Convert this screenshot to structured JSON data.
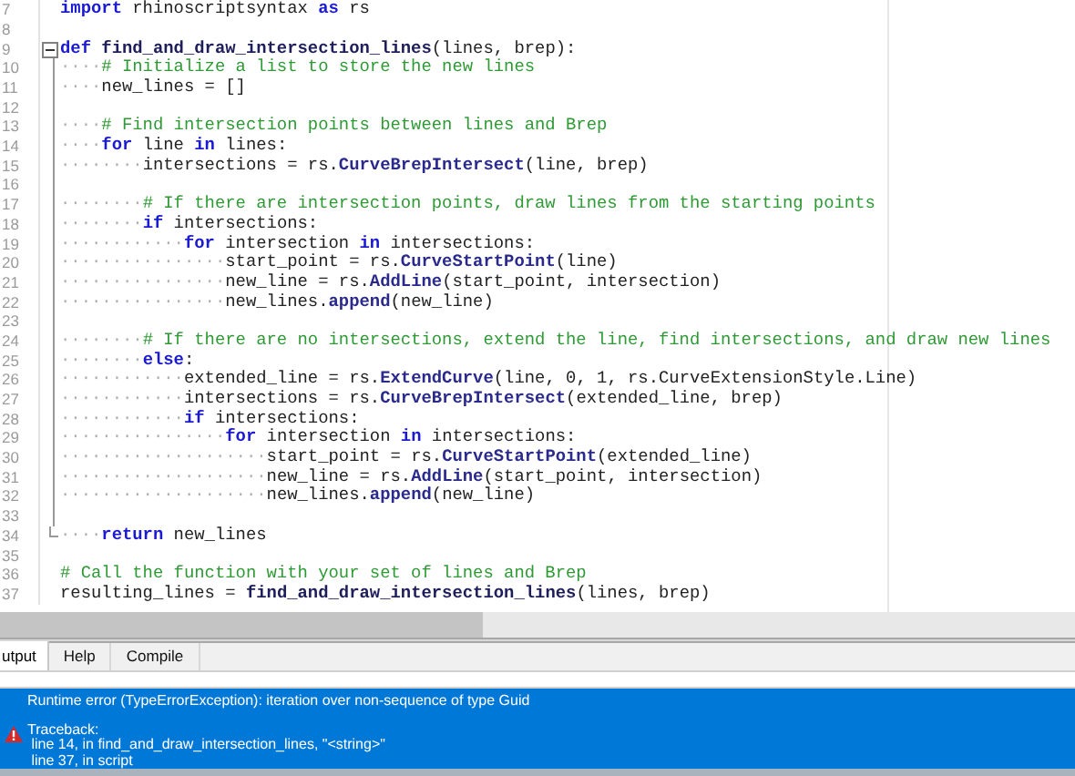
{
  "editor": {
    "lines": [
      {
        "number": "7",
        "segments": [
          {
            "kind": "keyword",
            "text": "import"
          },
          {
            "kind": "plain",
            "text": " rhinoscriptsyntax "
          },
          {
            "kind": "keyword",
            "text": "as"
          },
          {
            "kind": "plain",
            "text": " rs"
          }
        ]
      },
      {
        "number": "8"
      },
      {
        "number": "9",
        "kind": "fold_start",
        "segments": [
          {
            "kind": "keyword",
            "text": "def "
          },
          {
            "kind": "name",
            "text": "find_and_draw_intersection_lines"
          },
          {
            "kind": "plain",
            "text": "(lines, brep):"
          }
        ]
      },
      {
        "number": "10",
        "segments": [
          {
            "kind": "ws",
            "text": "····"
          },
          {
            "kind": "comment",
            "text": "# Initialize a list to store the new lines"
          }
        ]
      },
      {
        "number": "11",
        "segments": [
          {
            "kind": "ws",
            "text": "····"
          },
          {
            "kind": "plain",
            "text": "new_lines = []"
          }
        ]
      },
      {
        "number": "12"
      },
      {
        "number": "13",
        "segments": [
          {
            "kind": "ws",
            "text": "····"
          },
          {
            "kind": "comment",
            "text": "# Find intersection points between lines and Brep"
          }
        ]
      },
      {
        "number": "14",
        "segments": [
          {
            "kind": "ws",
            "text": "····"
          },
          {
            "kind": "keyword",
            "text": "for"
          },
          {
            "kind": "plain",
            "text": " line "
          },
          {
            "kind": "keyword",
            "text": "in"
          },
          {
            "kind": "plain",
            "text": " lines:"
          }
        ]
      },
      {
        "number": "15",
        "segments": [
          {
            "kind": "ws",
            "text": "········"
          },
          {
            "kind": "plain",
            "text": "intersections = rs."
          },
          {
            "kind": "call",
            "text": "CurveBrepIntersect"
          },
          {
            "kind": "plain",
            "text": "(line, brep)"
          }
        ]
      },
      {
        "number": "16"
      },
      {
        "number": "17",
        "segments": [
          {
            "kind": "ws",
            "text": "········"
          },
          {
            "kind": "comment",
            "text": "# If there are intersection points, draw lines from the starting points"
          }
        ]
      },
      {
        "number": "18",
        "segments": [
          {
            "kind": "ws",
            "text": "········"
          },
          {
            "kind": "keyword",
            "text": "if"
          },
          {
            "kind": "plain",
            "text": " intersections:"
          }
        ]
      },
      {
        "number": "19",
        "segments": [
          {
            "kind": "ws",
            "text": "············"
          },
          {
            "kind": "keyword",
            "text": "for"
          },
          {
            "kind": "plain",
            "text": " intersection "
          },
          {
            "kind": "keyword",
            "text": "in"
          },
          {
            "kind": "plain",
            "text": " intersections:"
          }
        ]
      },
      {
        "number": "20",
        "segments": [
          {
            "kind": "ws",
            "text": "················"
          },
          {
            "kind": "plain",
            "text": "start_point = rs."
          },
          {
            "kind": "call",
            "text": "CurveStartPoint"
          },
          {
            "kind": "plain",
            "text": "(line)"
          }
        ]
      },
      {
        "number": "21",
        "segments": [
          {
            "kind": "ws",
            "text": "················"
          },
          {
            "kind": "plain",
            "text": "new_line = rs."
          },
          {
            "kind": "call",
            "text": "AddLine"
          },
          {
            "kind": "plain",
            "text": "(start_point, intersection)"
          }
        ]
      },
      {
        "number": "22",
        "segments": [
          {
            "kind": "ws",
            "text": "················"
          },
          {
            "kind": "plain",
            "text": "new_lines."
          },
          {
            "kind": "call",
            "text": "append"
          },
          {
            "kind": "plain",
            "text": "(new_line)"
          }
        ]
      },
      {
        "number": "23"
      },
      {
        "number": "24",
        "segments": [
          {
            "kind": "ws",
            "text": "········"
          },
          {
            "kind": "comment",
            "text": "# If there are no intersections, extend the line, find intersections, and draw new lines"
          }
        ]
      },
      {
        "number": "25",
        "segments": [
          {
            "kind": "ws",
            "text": "········"
          },
          {
            "kind": "keyword",
            "text": "else"
          },
          {
            "kind": "plain",
            "text": ":"
          }
        ]
      },
      {
        "number": "26",
        "segments": [
          {
            "kind": "ws",
            "text": "············"
          },
          {
            "kind": "plain",
            "text": "extended_line = rs."
          },
          {
            "kind": "call",
            "text": "ExtendCurve"
          },
          {
            "kind": "plain",
            "text": "(line, 0, 1, rs.CurveExtensionStyle.Line)"
          }
        ]
      },
      {
        "number": "27",
        "segments": [
          {
            "kind": "ws",
            "text": "············"
          },
          {
            "kind": "plain",
            "text": "intersections = rs."
          },
          {
            "kind": "call",
            "text": "CurveBrepIntersect"
          },
          {
            "kind": "plain",
            "text": "(extended_line, brep)"
          }
        ]
      },
      {
        "number": "28",
        "segments": [
          {
            "kind": "ws",
            "text": "············"
          },
          {
            "kind": "keyword",
            "text": "if"
          },
          {
            "kind": "plain",
            "text": " intersections:"
          }
        ]
      },
      {
        "number": "29",
        "segments": [
          {
            "kind": "ws",
            "text": "················"
          },
          {
            "kind": "keyword",
            "text": "for"
          },
          {
            "kind": "plain",
            "text": " intersection "
          },
          {
            "kind": "keyword",
            "text": "in"
          },
          {
            "kind": "plain",
            "text": " intersections:"
          }
        ]
      },
      {
        "number": "30",
        "segments": [
          {
            "kind": "ws",
            "text": "····················"
          },
          {
            "kind": "plain",
            "text": "start_point = rs."
          },
          {
            "kind": "call",
            "text": "CurveStartPoint"
          },
          {
            "kind": "plain",
            "text": "(extended_line)"
          }
        ]
      },
      {
        "number": "31",
        "segments": [
          {
            "kind": "ws",
            "text": "····················"
          },
          {
            "kind": "plain",
            "text": "new_line = rs."
          },
          {
            "kind": "call",
            "text": "AddLine"
          },
          {
            "kind": "plain",
            "text": "(start_point, intersection)"
          }
        ]
      },
      {
        "number": "32",
        "segments": [
          {
            "kind": "ws",
            "text": "····················"
          },
          {
            "kind": "plain",
            "text": "new_lines."
          },
          {
            "kind": "call",
            "text": "append"
          },
          {
            "kind": "plain",
            "text": "(new_line)"
          }
        ]
      },
      {
        "number": "33"
      },
      {
        "number": "34",
        "kind": "fold_end",
        "segments": [
          {
            "kind": "ws",
            "text": "····"
          },
          {
            "kind": "keyword",
            "text": "return"
          },
          {
            "kind": "plain",
            "text": " new_lines"
          }
        ]
      },
      {
        "number": "35"
      },
      {
        "number": "36",
        "segments": [
          {
            "kind": "comment",
            "text": "# Call the function with your set of lines and Brep"
          }
        ]
      },
      {
        "number": "37",
        "segments": [
          {
            "kind": "plain",
            "text": "resulting_lines = "
          },
          {
            "kind": "name",
            "text": "find_and_draw_intersection_lines"
          },
          {
            "kind": "plain",
            "text": "(lines, brep)"
          }
        ]
      }
    ]
  },
  "tabs": [
    {
      "label": "utput",
      "selected": true
    },
    {
      "label": "Help",
      "selected": false
    },
    {
      "label": "Compile",
      "selected": false
    }
  ],
  "output": {
    "message": "Runtime error (TypeErrorException): iteration over non-sequence of type Guid",
    "traceback_title": "Traceback:",
    "traceback": [
      " line 14, in find_and_draw_intersection_lines, \"<string>\"",
      " line 37, in script"
    ]
  }
}
